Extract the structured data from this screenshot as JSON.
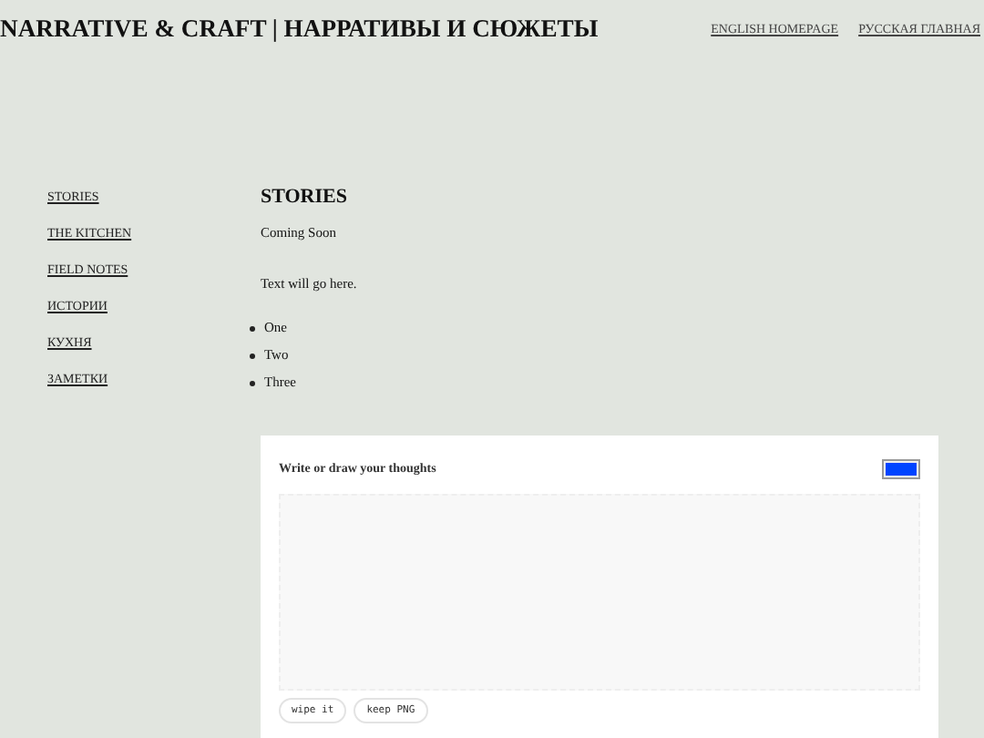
{
  "header": {
    "title": "NARRATIVE & CRAFT | НАРРАТИВЫ И СЮЖЕТЫ",
    "links": [
      "ENGLISH HOMEPAGE",
      "РУССКАЯ ГЛАВНАЯ"
    ]
  },
  "sidebar": {
    "items": [
      "STORIES",
      "THE KITCHEN",
      "FIELD NOTES",
      "ИСТОРИИ",
      "КУХНЯ",
      "ЗАМЕТКИ"
    ]
  },
  "content": {
    "heading": "STORIES",
    "subtitle": "Coming Soon",
    "body": "Text will go here.",
    "list": [
      "One",
      "Two",
      "Three"
    ]
  },
  "drawing_card": {
    "title": "Write or draw your thoughts",
    "swatch": {
      "color": "#0044ff"
    },
    "buttons": [
      "wipe it",
      "keep PNG"
    ]
  }
}
